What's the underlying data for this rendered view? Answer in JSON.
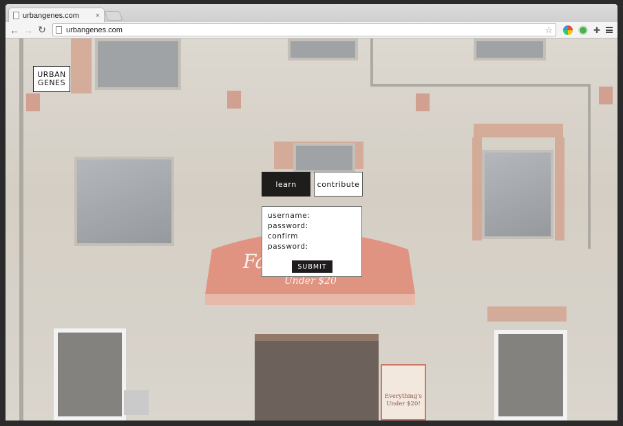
{
  "browser": {
    "tab_title": "urbangenes.com",
    "tab_close": "×",
    "url": "urbangenes.com",
    "star_icon": "star-icon",
    "extensions": [
      "chromatic-icon",
      "green-circle-icon",
      "puzzle-icon"
    ],
    "menu_icon": "hamburger-menu-icon"
  },
  "logo": {
    "line1": "URBAN",
    "line2": "GENES"
  },
  "auth": {
    "tabs": [
      {
        "label": "learn",
        "active": true
      },
      {
        "label": "contribute",
        "active": false
      }
    ],
    "fields": [
      "username:",
      "password:",
      "confirm",
      "password:"
    ],
    "submit_label": "SUBMIT"
  },
  "background_text": {
    "awning_main": "Fa                ds",
    "awning_sub": "Under $20",
    "poster_line1": "Everything's",
    "poster_line2": "Under $20!"
  },
  "colors": {
    "accent_dark": "#1f1c1c",
    "awning": "#d9735c"
  }
}
